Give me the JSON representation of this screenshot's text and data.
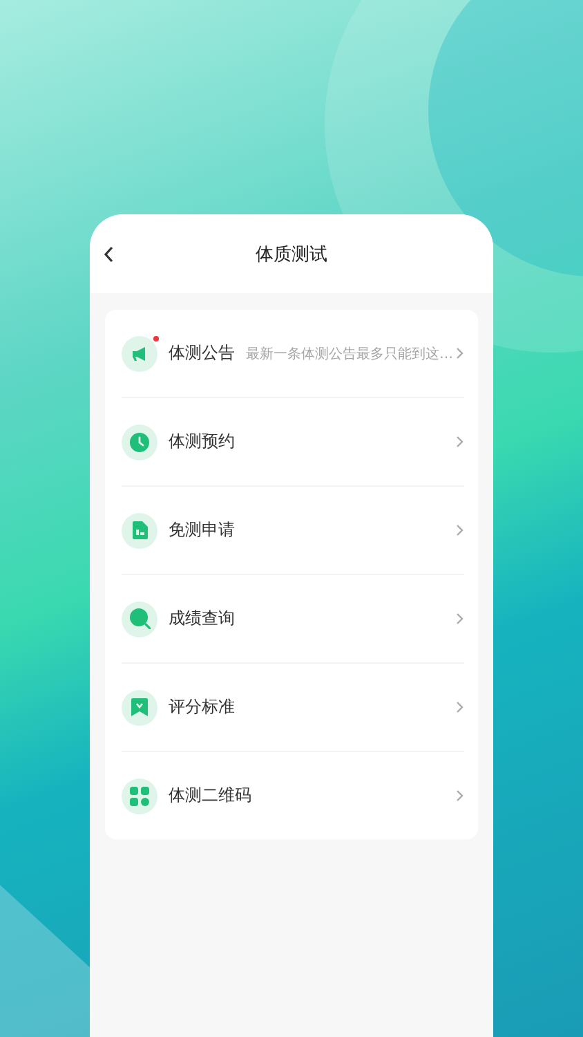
{
  "header": {
    "title": "体质测试"
  },
  "menu": [
    {
      "kind": "megaphone",
      "label": "体测公告",
      "unread": true,
      "subtitle": "最新一条体测公告最多只能到这…"
    },
    {
      "kind": "clock",
      "label": "体测预约",
      "unread": false
    },
    {
      "kind": "document",
      "label": "免测申请",
      "unread": false
    },
    {
      "kind": "search",
      "label": "成绩查询",
      "unread": false
    },
    {
      "kind": "bookmark",
      "label": "评分标准",
      "unread": false
    },
    {
      "kind": "grid",
      "label": "体测二维码",
      "unread": false
    }
  ]
}
